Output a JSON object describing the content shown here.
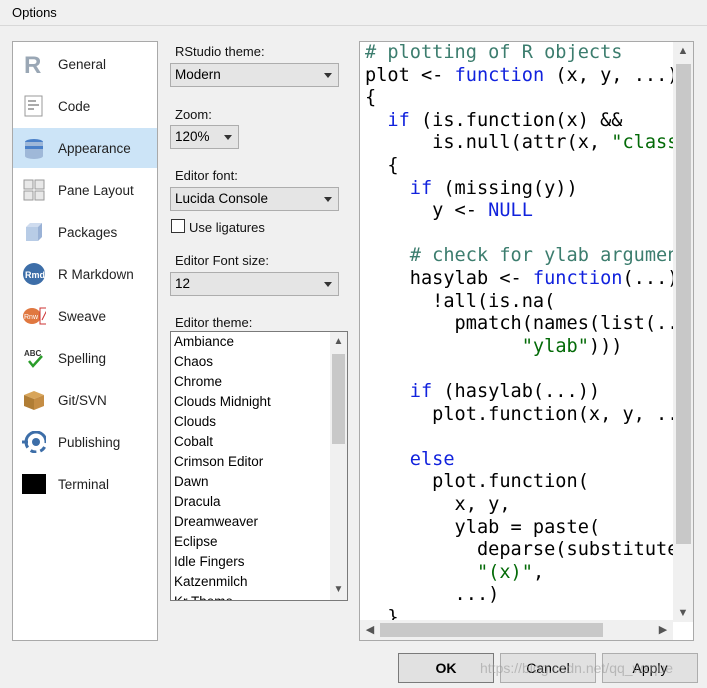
{
  "window": {
    "title": "Options"
  },
  "sidebar": {
    "items": [
      {
        "label": "General",
        "icon": "r-logo-icon"
      },
      {
        "label": "Code",
        "icon": "code-icon"
      },
      {
        "label": "Appearance",
        "icon": "appearance-icon",
        "active": true
      },
      {
        "label": "Pane Layout",
        "icon": "pane-layout-icon"
      },
      {
        "label": "Packages",
        "icon": "packages-icon"
      },
      {
        "label": "R Markdown",
        "icon": "rmarkdown-icon"
      },
      {
        "label": "Sweave",
        "icon": "sweave-icon"
      },
      {
        "label": "Spelling",
        "icon": "spelling-icon"
      },
      {
        "label": "Git/SVN",
        "icon": "git-svn-icon"
      },
      {
        "label": "Publishing",
        "icon": "publishing-icon"
      },
      {
        "label": "Terminal",
        "icon": "terminal-icon"
      }
    ]
  },
  "appearance": {
    "rstudio_theme_label": "RStudio theme:",
    "rstudio_theme_value": "Modern",
    "zoom_label": "Zoom:",
    "zoom_value": "120%",
    "editor_font_label": "Editor font:",
    "editor_font_value": "Lucida Console",
    "use_ligatures_label": "Use ligatures",
    "use_ligatures_checked": false,
    "editor_font_size_label": "Editor Font size:",
    "editor_font_size_value": "12",
    "editor_theme_label": "Editor theme:",
    "editor_themes": [
      "Ambiance",
      "Chaos",
      "Chrome",
      "Clouds Midnight",
      "Clouds",
      "Cobalt",
      "Crimson Editor",
      "Dawn",
      "Dracula",
      "Dreamweaver",
      "Eclipse",
      "Idle Fingers",
      "Katzenmilch",
      "Kr Theme"
    ]
  },
  "preview": {
    "lines": [
      [
        [
          "com",
          "# plotting of R objects"
        ]
      ],
      [
        [
          "id",
          "plot "
        ],
        [
          "id",
          "<- "
        ],
        [
          "kw",
          "function"
        ],
        [
          "id",
          " (x, y, ...)"
        ]
      ],
      [
        [
          "id",
          "{"
        ]
      ],
      [
        [
          "id",
          "  "
        ],
        [
          "kw",
          "if"
        ],
        [
          "id",
          " (is.function(x) &&"
        ]
      ],
      [
        [
          "id",
          "      is.null(attr(x, "
        ],
        [
          "str",
          "\"class"
        ]
      ],
      [
        [
          "id",
          "  {"
        ]
      ],
      [
        [
          "id",
          "    "
        ],
        [
          "kw",
          "if"
        ],
        [
          "id",
          " (missing(y))"
        ]
      ],
      [
        [
          "id",
          "      y <- "
        ],
        [
          "kw",
          "NULL"
        ]
      ],
      [
        [
          "id",
          ""
        ]
      ],
      [
        [
          "id",
          "    "
        ],
        [
          "com",
          "# check for ylab argumen"
        ]
      ],
      [
        [
          "id",
          "    hasylab <- "
        ],
        [
          "kw",
          "function"
        ],
        [
          "id",
          "(...)"
        ]
      ],
      [
        [
          "id",
          "      !all(is.na("
        ]
      ],
      [
        [
          "id",
          "        pmatch(names(list(.."
        ]
      ],
      [
        [
          "id",
          "              "
        ],
        [
          "str",
          "\"ylab\""
        ],
        [
          "id",
          ")))"
        ]
      ],
      [
        [
          "id",
          ""
        ]
      ],
      [
        [
          "id",
          "    "
        ],
        [
          "kw",
          "if"
        ],
        [
          "id",
          " (hasylab(...))"
        ]
      ],
      [
        [
          "id",
          "      plot.function(x, y, .."
        ]
      ],
      [
        [
          "id",
          ""
        ]
      ],
      [
        [
          "id",
          "    "
        ],
        [
          "kw",
          "else"
        ]
      ],
      [
        [
          "id",
          "      plot.function("
        ]
      ],
      [
        [
          "id",
          "        x, y,"
        ]
      ],
      [
        [
          "id",
          "        ylab = paste("
        ]
      ],
      [
        [
          "id",
          "          deparse(substitute"
        ]
      ],
      [
        [
          "id",
          "          "
        ],
        [
          "str",
          "\"(x)\""
        ],
        [
          "id",
          ","
        ]
      ],
      [
        [
          "id",
          "        ...)"
        ]
      ],
      [
        [
          "id",
          "  }"
        ]
      ]
    ]
  },
  "buttons": {
    "ok": "OK",
    "cancel": "Cancel",
    "apply": "Apply"
  },
  "watermark": "https://blog.csdn.net/qq_wxque",
  "colors": {
    "active_bg": "#cce4f7",
    "keyword": "#1122dd",
    "comment": "#3c7d6e",
    "string": "#036a07"
  }
}
